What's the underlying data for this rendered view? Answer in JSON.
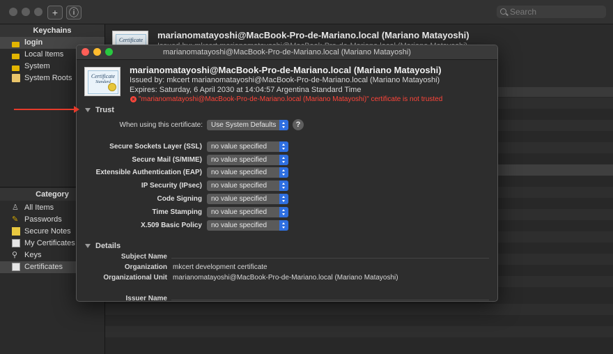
{
  "toolbar": {
    "search_placeholder": "Search",
    "add_glyph": "+",
    "info_glyph": "ⓘ"
  },
  "sidebar": {
    "keychains_header": "Keychains",
    "keychains": [
      {
        "label": "login",
        "icon": "lock-open-icon",
        "selected": true
      },
      {
        "label": "Local Items",
        "icon": "lock-open-icon"
      },
      {
        "label": "System",
        "icon": "lock-icon"
      },
      {
        "label": "System Roots",
        "icon": "folder-icon"
      }
    ],
    "category_header": "Category",
    "categories": [
      {
        "label": "All Items",
        "icon": "people-icon"
      },
      {
        "label": "Passwords",
        "icon": "pen-icon"
      },
      {
        "label": "Secure Notes",
        "icon": "note-icon"
      },
      {
        "label": "My Certificates",
        "icon": "certificate-icon"
      },
      {
        "label": "Keys",
        "icon": "key-icon"
      },
      {
        "label": "Certificates",
        "icon": "certificate-icon",
        "selected": true
      }
    ]
  },
  "main_header": {
    "title": "marianomatayoshi@MacBook-Pro-de-Mariano.local (Mariano Matayoshi)",
    "subtitle": "Issued by: mkcert marianomatayoshi@MacBook-Pro-de-Mariano.local (Mariano Matayoshi)"
  },
  "dialog": {
    "title": "marianomatayoshi@MacBook-Pro-de-Mariano.local (Mariano Matayoshi)",
    "cert_name": "marianomatayoshi@MacBook-Pro-de-Mariano.local (Mariano Matayoshi)",
    "issued_by": "Issued by: mkcert marianomatayoshi@MacBook-Pro-de-Mariano.local (Mariano Matayoshi)",
    "expires": "Expires: Saturday, 6 April 2030 at 14:04:57 Argentina Standard Time",
    "error": "\"marianomatayoshi@MacBook-Pro-de-Mariano.local (Mariano Matayoshi)\" certificate is not trusted",
    "cert_thumbnail_text": "Certificate",
    "cert_thumbnail_sub": "Standard",
    "trust": {
      "header": "Trust",
      "when_using_label": "When using this certificate:",
      "when_using_value": "Use System Defaults",
      "help_glyph": "?",
      "policies": [
        {
          "label": "Secure Sockets Layer (SSL)",
          "value": "no value specified"
        },
        {
          "label": "Secure Mail (S/MIME)",
          "value": "no value specified"
        },
        {
          "label": "Extensible Authentication (EAP)",
          "value": "no value specified"
        },
        {
          "label": "IP Security (IPsec)",
          "value": "no value specified"
        },
        {
          "label": "Code Signing",
          "value": "no value specified"
        },
        {
          "label": "Time Stamping",
          "value": "no value specified"
        },
        {
          "label": "X.509 Basic Policy",
          "value": "no value specified"
        }
      ]
    },
    "details": {
      "header": "Details",
      "subject_name_label": "Subject Name",
      "organization_label": "Organization",
      "organization_value": "mkcert development certificate",
      "org_unit_label": "Organizational Unit",
      "org_unit_value": "marianomatayoshi@MacBook-Pro-de-Mariano.local (Mariano Matayoshi)",
      "issuer_name_label": "Issuer Name"
    }
  },
  "colors": {
    "error": "#ff453a",
    "accent": "#2f6fe0",
    "arrow": "#e53a2a"
  }
}
